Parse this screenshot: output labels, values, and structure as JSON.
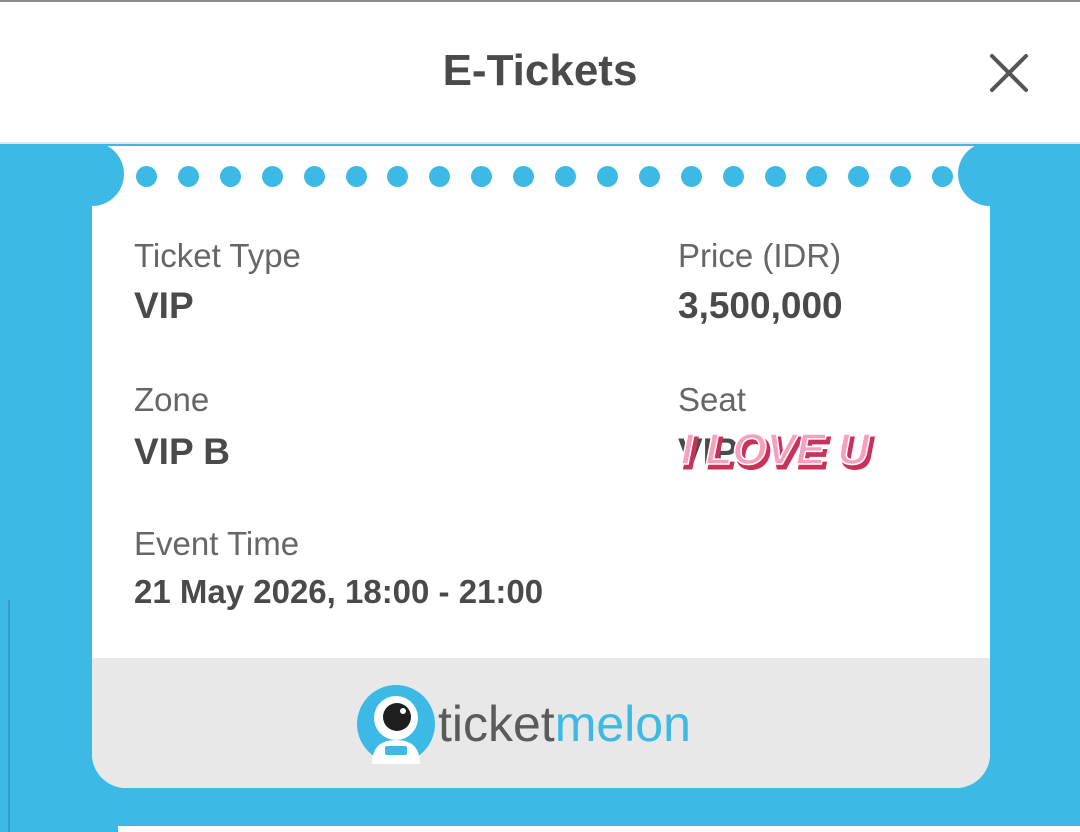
{
  "header": {
    "title": "E-Tickets",
    "close_icon": "close-icon"
  },
  "ticket": {
    "ticket_type_label": "Ticket Type",
    "ticket_type_value": "VIP",
    "price_label": "Price (IDR)",
    "price_value": "3,500,000",
    "zone_label": "Zone",
    "zone_value": "VIP B",
    "seat_label": "Seat",
    "seat_value": "VIP",
    "sticker_text": "I LOVE U",
    "event_time_label": "Event Time",
    "event_time_value": "21 May 2026, 18:00 - 21:00"
  },
  "footer": {
    "logo_part1": "ticket",
    "logo_part2": "melon",
    "logo_icon": "astronaut-icon"
  },
  "colors": {
    "accent": "#3db9e6",
    "text_dark": "#4a4a4a",
    "text_label": "#666666",
    "footer_bg": "#e8e8e8",
    "sticker_pink": "#f07aa0"
  }
}
